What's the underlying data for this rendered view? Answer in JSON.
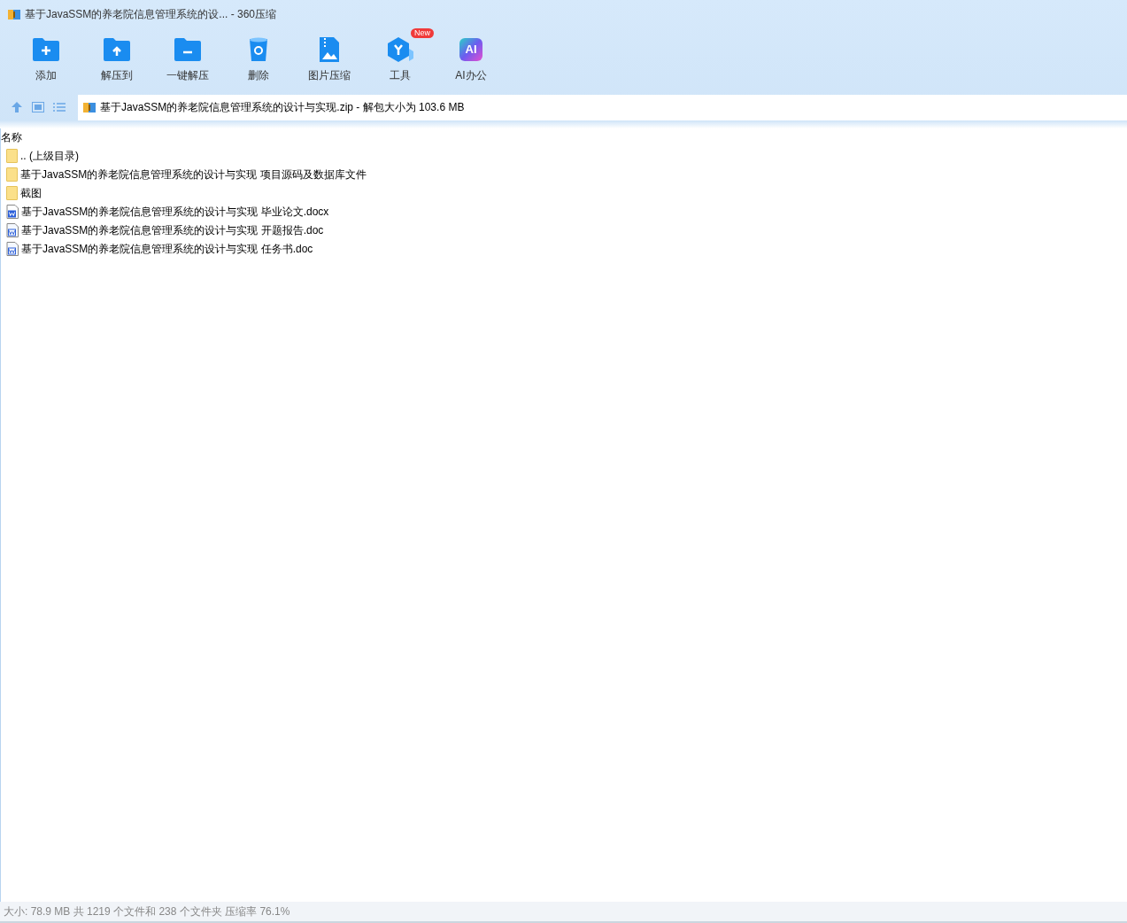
{
  "window": {
    "title": "基于JavaSSM的养老院信息管理系统的设... - 360压缩"
  },
  "toolbar": [
    {
      "kind": "add",
      "label": "添加"
    },
    {
      "kind": "extract",
      "label": "解压到"
    },
    {
      "kind": "oneclick",
      "label": "一键解压"
    },
    {
      "kind": "delete",
      "label": "删除"
    },
    {
      "kind": "image",
      "label": "图片压缩"
    },
    {
      "kind": "tools",
      "label": "工具",
      "badge": "New"
    },
    {
      "kind": "ai",
      "label": "AI办公",
      "icon_text": "AI"
    }
  ],
  "address": {
    "text": "基于JavaSSM的养老院信息管理系统的设计与实现.zip - 解包大小为 103.6 MB"
  },
  "table": {
    "columns": [
      "名称"
    ],
    "rows": [
      {
        "kind": "folder",
        "name": ".. (上级目录)"
      },
      {
        "kind": "folder",
        "name": "基于JavaSSM的养老院信息管理系统的设计与实现 项目源码及数据库文件"
      },
      {
        "kind": "folder",
        "name": "截图"
      },
      {
        "kind": "docx",
        "name": "基于JavaSSM的养老院信息管理系统的设计与实现 毕业论文.docx"
      },
      {
        "kind": "doc",
        "name": "基于JavaSSM的养老院信息管理系统的设计与实现 开题报告.doc"
      },
      {
        "kind": "doc",
        "name": "基于JavaSSM的养老院信息管理系统的设计与实现 任务书.doc"
      }
    ]
  },
  "status_bar": "大小: 78.9 MB 共 1219 个文件和 238 个文件夹 压缩率 76.1%"
}
